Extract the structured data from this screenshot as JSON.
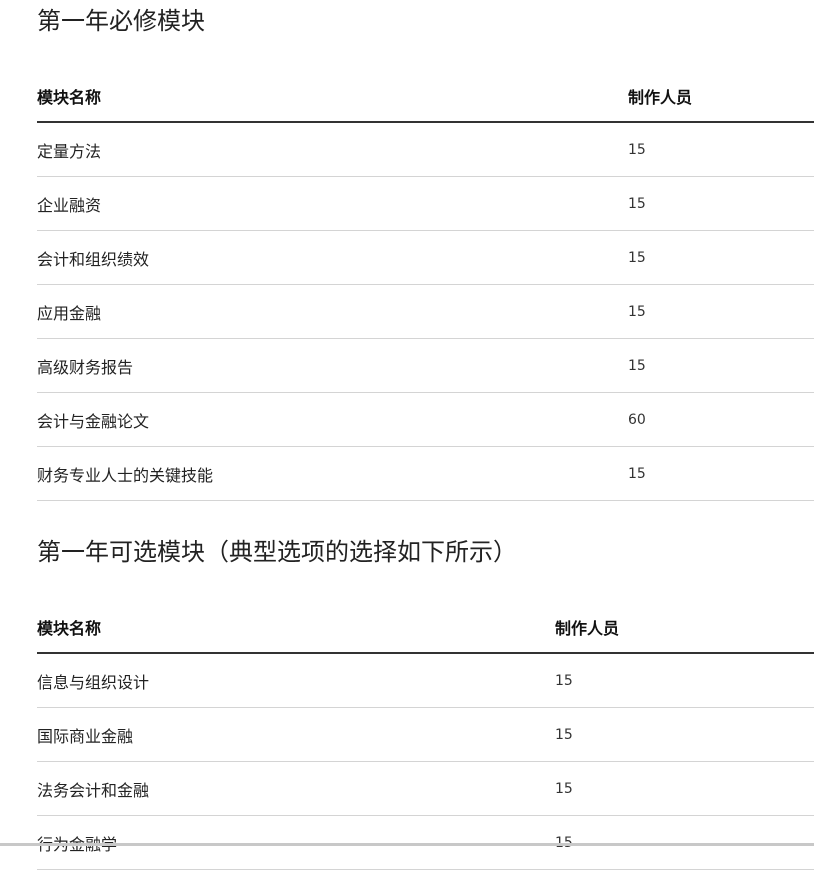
{
  "sections": [
    {
      "title": "第一年必修模块",
      "headers": {
        "name": "模块名称",
        "staff": "制作人员"
      },
      "rows": [
        {
          "name": "定量方法",
          "staff": "15"
        },
        {
          "name": "企业融资",
          "staff": "15"
        },
        {
          "name": "会计和组织绩效",
          "staff": "15"
        },
        {
          "name": "应用金融",
          "staff": "15"
        },
        {
          "name": "高级财务报告",
          "staff": "15"
        },
        {
          "name": "会计与金融论文",
          "staff": "60"
        },
        {
          "name": "财务专业人士的关键技能",
          "staff": "15"
        }
      ]
    },
    {
      "title": "第一年可选模块（典型选项的选择如下所示）",
      "headers": {
        "name": "模块名称",
        "staff": "制作人员"
      },
      "rows": [
        {
          "name": "信息与组织设计",
          "staff": "15"
        },
        {
          "name": "国际商业金融",
          "staff": "15"
        },
        {
          "name": "法务会计和金融",
          "staff": "15"
        },
        {
          "name": "行为金融学",
          "staff": "15"
        }
      ]
    }
  ]
}
